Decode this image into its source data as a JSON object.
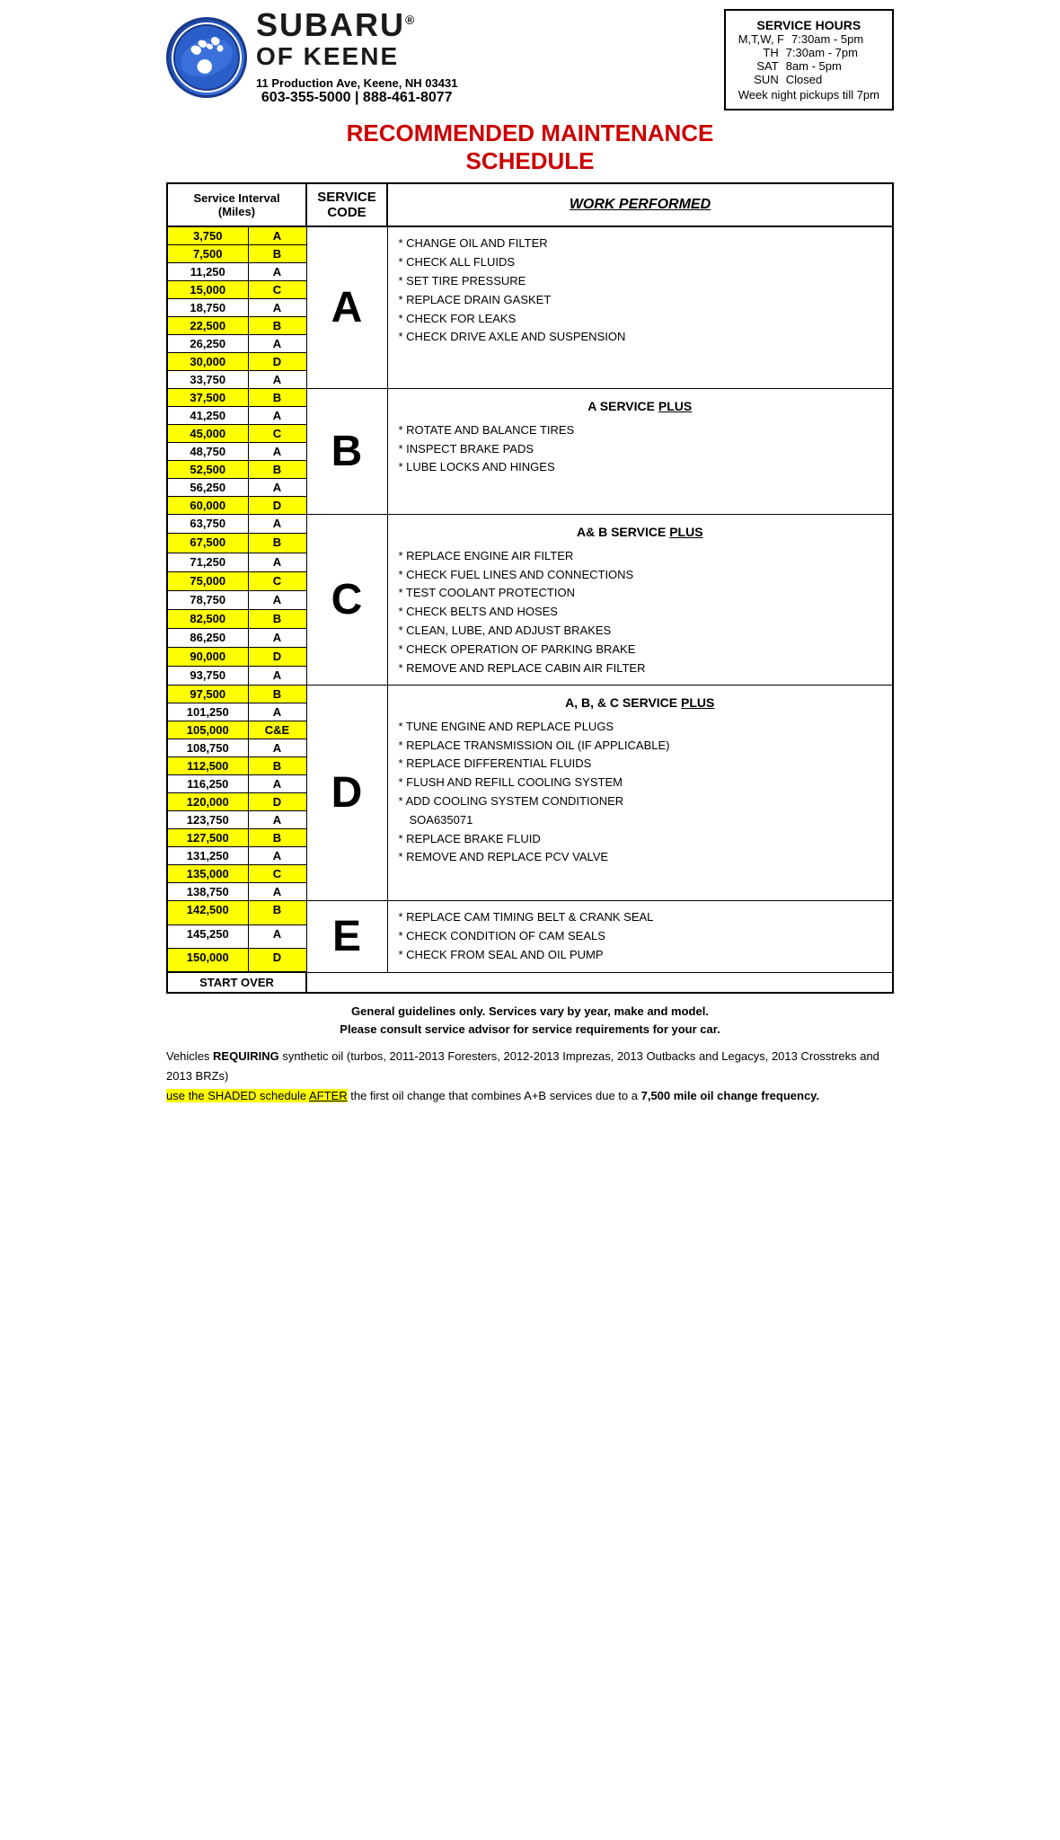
{
  "header": {
    "dealership": "SUBARU",
    "dealership_suffix": "®",
    "of_keene": "OF KEENE",
    "address": "11 Production Ave, Keene, NH  03431",
    "phone": "603-355-5000 | 888-461-8077",
    "hours_title": "SERVICE HOURS",
    "hours": [
      {
        "days": "M,T,W, F",
        "time": "7:30am - 5pm"
      },
      {
        "days": "TH",
        "time": "7:30am - 7pm"
      },
      {
        "days": "SAT",
        "time": "8am - 5pm"
      },
      {
        "days": "SUN",
        "time": "Closed"
      },
      {
        "days_note": "Week night pickups till 7pm"
      }
    ]
  },
  "schedule_title_line1": "RECOMMENDED MAINTENANCE",
  "schedule_title_line2": "SCHEDULE",
  "table_headers": {
    "interval": "Service Interval (Miles)",
    "code": "Service Code",
    "service_code": "SERVICE CODE",
    "work": "WORK PERFORMED"
  },
  "intervals": [
    {
      "miles": "3,750",
      "code": "A",
      "yellow": true
    },
    {
      "miles": "7,500",
      "code": "B",
      "yellow": true
    },
    {
      "miles": "11,250",
      "code": "A",
      "yellow": false
    },
    {
      "miles": "15,000",
      "code": "C",
      "yellow": true
    },
    {
      "miles": "18,750",
      "code": "A",
      "yellow": false
    },
    {
      "miles": "22,500",
      "code": "B",
      "yellow": true
    },
    {
      "miles": "26,250",
      "code": "A",
      "yellow": false
    },
    {
      "miles": "30,000",
      "code": "D",
      "yellow": true
    },
    {
      "miles": "33,750",
      "code": "A",
      "yellow": false
    },
    {
      "miles": "37,500",
      "code": "B",
      "yellow": true
    },
    {
      "miles": "41,250",
      "code": "A",
      "yellow": false
    },
    {
      "miles": "45,000",
      "code": "C",
      "yellow": true
    },
    {
      "miles": "48,750",
      "code": "A",
      "yellow": false
    },
    {
      "miles": "52,500",
      "code": "B",
      "yellow": true
    },
    {
      "miles": "56,250",
      "code": "A",
      "yellow": false
    },
    {
      "miles": "60,000",
      "code": "D",
      "yellow": true
    },
    {
      "miles": "63,750",
      "code": "A",
      "yellow": false
    },
    {
      "miles": "67,500",
      "code": "B",
      "yellow": true
    },
    {
      "miles": "71,250",
      "code": "A",
      "yellow": false
    },
    {
      "miles": "75,000",
      "code": "C",
      "yellow": true
    },
    {
      "miles": "78,750",
      "code": "A",
      "yellow": false
    },
    {
      "miles": "82,500",
      "code": "B",
      "yellow": true
    },
    {
      "miles": "86,250",
      "code": "A",
      "yellow": false
    },
    {
      "miles": "90,000",
      "code": "D",
      "yellow": true
    },
    {
      "miles": "93,750",
      "code": "A",
      "yellow": false
    },
    {
      "miles": "97,500",
      "code": "B",
      "yellow": true
    },
    {
      "miles": "101,250",
      "code": "A",
      "yellow": false
    },
    {
      "miles": "105,000",
      "code": "C&E",
      "yellow": true
    },
    {
      "miles": "108,750",
      "code": "A",
      "yellow": false
    },
    {
      "miles": "112,500",
      "code": "B",
      "yellow": true
    },
    {
      "miles": "116,250",
      "code": "A",
      "yellow": false
    },
    {
      "miles": "120,000",
      "code": "D",
      "yellow": true
    },
    {
      "miles": "123,750",
      "code": "A",
      "yellow": false
    },
    {
      "miles": "127,500",
      "code": "B",
      "yellow": true
    },
    {
      "miles": "131,250",
      "code": "A",
      "yellow": false
    },
    {
      "miles": "135,000",
      "code": "C",
      "yellow": true
    },
    {
      "miles": "138,750",
      "code": "A",
      "yellow": false
    },
    {
      "miles": "142,500",
      "code": "B",
      "yellow": true
    },
    {
      "miles": "145,250",
      "code": "A",
      "yellow": false
    },
    {
      "miles": "150,000",
      "code": "D",
      "yellow": true
    }
  ],
  "start_over": "START OVER",
  "services": {
    "A": {
      "letter": "A",
      "items": [
        "CHANGE OIL AND FILTER",
        "CHECK ALL FLUIDS",
        "SET TIRE PRESSURE",
        "REPLACE DRAIN GASKET",
        "CHECK FOR LEAKS",
        "CHECK DRIVE AXLE AND SUSPENSION"
      ]
    },
    "B": {
      "letter": "B",
      "header": "A SERVICE PLUS",
      "items": [
        "ROTATE AND BALANCE TIRES",
        "INSPECT BRAKE PADS",
        "LUBE LOCKS AND HINGES"
      ]
    },
    "C": {
      "letter": "C",
      "header": "A& B SERVICE PLUS",
      "items": [
        "REPLACE ENGINE AIR FILTER",
        "CHECK FUEL LINES AND CONNECTIONS",
        "TEST COOLANT PROTECTION",
        "CHECK BELTS AND HOSES",
        "CLEAN, LUBE, AND ADJUST BRAKES",
        "CHECK OPERATION OF PARKING BRAKE",
        "REMOVE AND REPLACE CABIN AIR FILTER"
      ]
    },
    "D": {
      "letter": "D",
      "header": "A, B, & C SERVICE PLUS",
      "items": [
        "TUNE ENGINE AND REPLACE PLUGS",
        "REPLACE TRANSMISSION OIL (IF APPLICABLE)",
        "REPLACE DIFFERENTIAL FLUIDS",
        "FLUSH AND REFILL COOLING SYSTEM",
        "ADD COOLING SYSTEM CONDITIONER SOA635071",
        "REPLACE BRAKE FLUID",
        "REMOVE AND REPLACE PCV VALVE"
      ]
    },
    "E": {
      "letter": "E",
      "items": [
        "REPLACE CAM TIMING BELT & CRANK SEAL",
        "CHECK CONDITION OF CAM SEALS",
        "CHECK FROM SEAL AND OIL PUMP"
      ]
    }
  },
  "footer": {
    "guideline1": "General guidelines only. Services vary by year, make and model.",
    "guideline2": "Please consult service advisor for service requirements for your car.",
    "synthetic_intro": "Vehicles ",
    "requiring": "REQUIRING",
    "synthetic_mid": " synthetic oil (turbos, 2011-2013 Foresters, 2012-2013 Imprezas, 2013 Outbacks and Legacys, 2013 Crosstreks and 2013 BRZs)",
    "use_shaded": "use the SHADED schedule ",
    "after_word": "AFTER",
    "synthetic_end": " the first oil change that combines A+B services due to a ",
    "frequency": "7,500 mile oil change frequency.",
    "shaded_note": "7,500 mile oil change frequency"
  }
}
